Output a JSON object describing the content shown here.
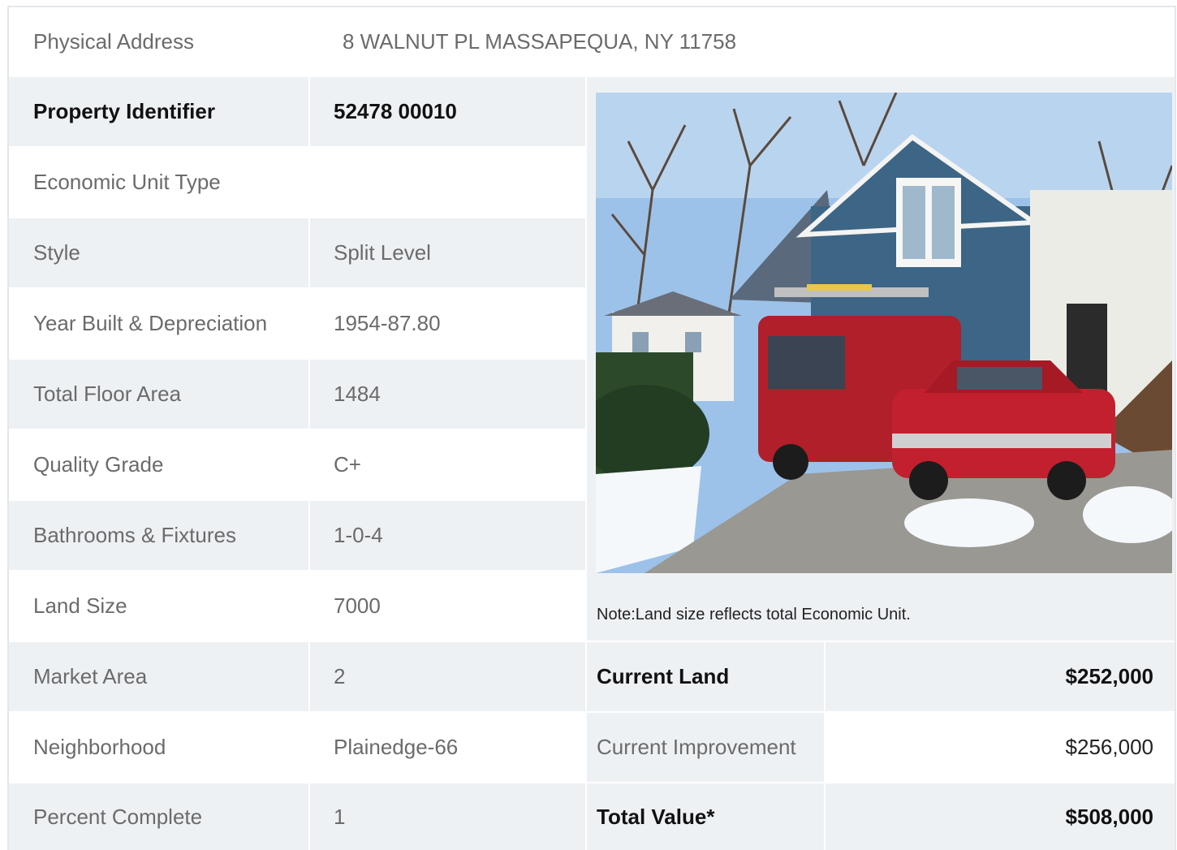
{
  "address": {
    "label": "Physical Address",
    "value": "8  WALNUT PL  MASSAPEQUA, NY  11758"
  },
  "rows": [
    {
      "label": "Property Identifier",
      "value": "52478  00010"
    },
    {
      "label": "Economic Unit Type",
      "value": ""
    },
    {
      "label": "Style",
      "value": "Split Level"
    },
    {
      "label": "Year Built & Depreciation",
      "value": "1954-87.80"
    },
    {
      "label": "Total Floor Area",
      "value": "1484"
    },
    {
      "label": "Quality Grade",
      "value": "C+"
    },
    {
      "label": "Bathrooms & Fixtures",
      "value": "1-0-4"
    },
    {
      "label": "Land Size",
      "value": "7000"
    },
    {
      "label": "Market Area",
      "value": "2"
    },
    {
      "label": "Neighborhood",
      "value": "Plainedge-66"
    },
    {
      "label": "Percent Complete",
      "value": "1"
    }
  ],
  "note": "Note:Land size reflects total Economic Unit.",
  "values": [
    {
      "label": "Current Land",
      "value": "$252,000"
    },
    {
      "label": "Current Improvement",
      "value": "$256,000"
    },
    {
      "label": "Total Value*",
      "value": "$508,000"
    }
  ],
  "colors": {
    "shade": "#eef1f4",
    "border": "#e4e7ea",
    "text": "#6b6b6b",
    "bold": "#111111"
  }
}
